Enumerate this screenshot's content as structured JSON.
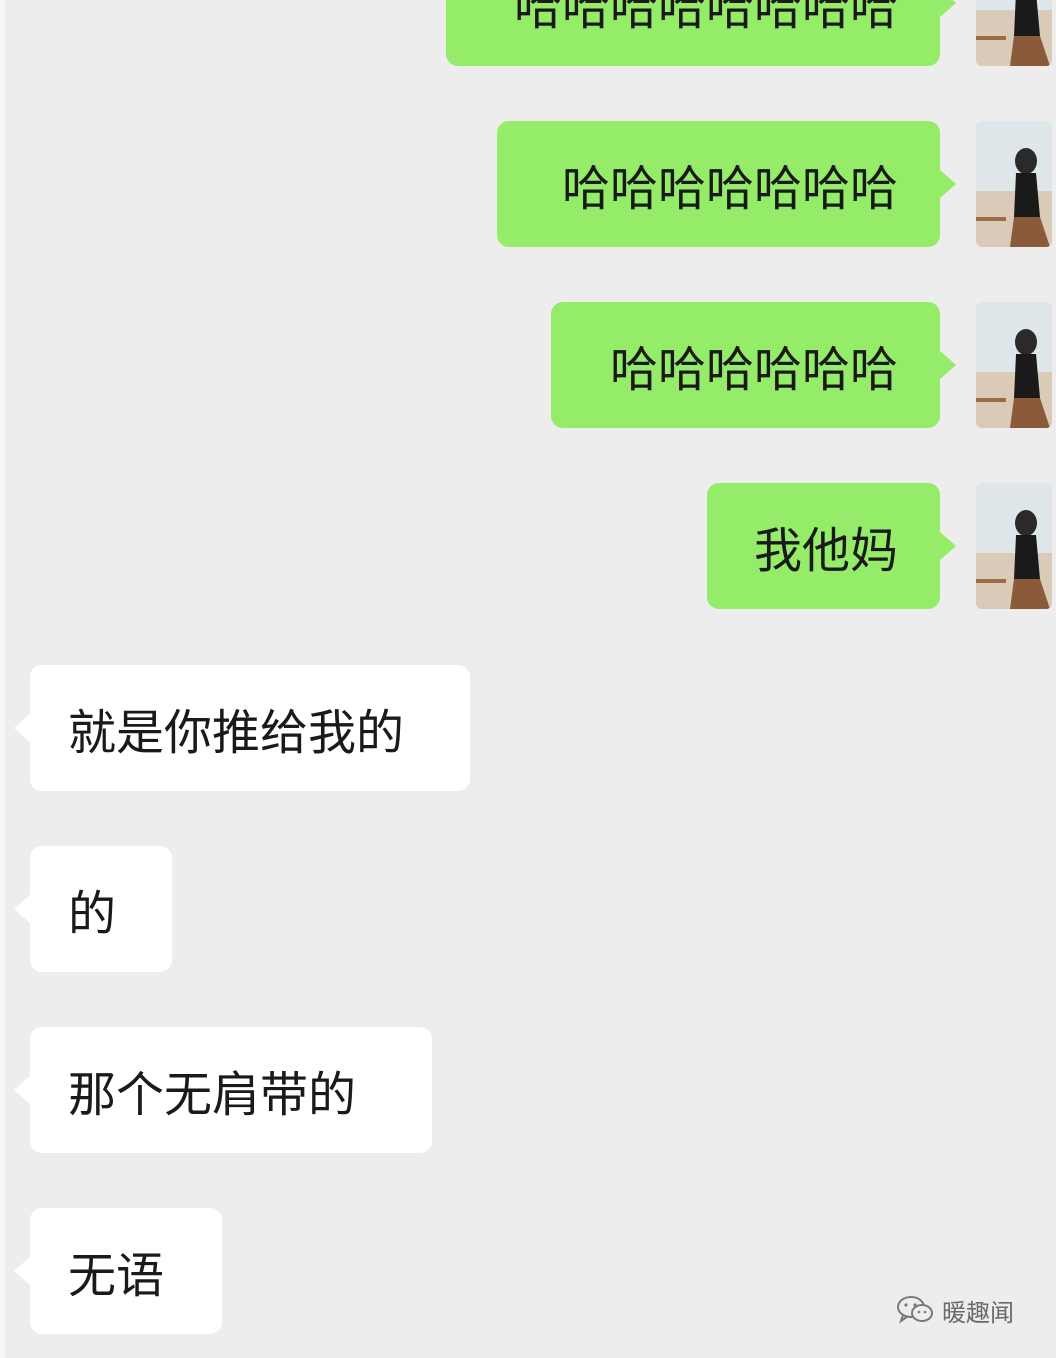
{
  "messages": [
    {
      "side": "sent",
      "text": "哈哈哈哈哈哈哈哈"
    },
    {
      "side": "sent",
      "text": "哈哈哈哈哈哈哈"
    },
    {
      "side": "sent",
      "text": "哈哈哈哈哈哈"
    },
    {
      "side": "sent",
      "text": "我他妈"
    },
    {
      "side": "received",
      "text": "就是你推给我的"
    },
    {
      "side": "received",
      "text": "的"
    },
    {
      "side": "received",
      "text": "那个无肩带的"
    },
    {
      "side": "received",
      "text": "无语"
    }
  ],
  "watermark": {
    "icon": "wechat-icon",
    "text": "暖趣闻"
  },
  "colors": {
    "background": "#ededed",
    "sent_bubble": "#95ec69",
    "received_bubble": "#ffffff",
    "text": "#1a1a1a"
  }
}
